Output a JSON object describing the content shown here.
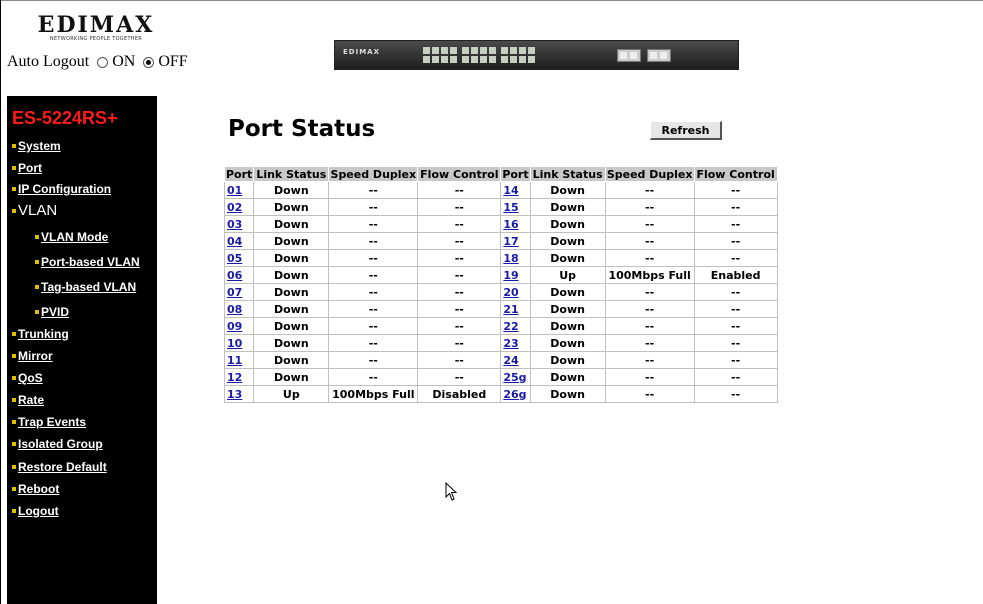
{
  "header": {
    "logo_text": "EDIMAX",
    "logo_tagline": "NETWORKING PEOPLE TOGETHER",
    "auto_logout_label": "Auto Logout",
    "option_on": "ON",
    "option_off": "OFF",
    "auto_logout_selected": "OFF",
    "device_brand": "EDIMAX"
  },
  "sidebar": {
    "model": "ES-5224RS+",
    "items": [
      {
        "label": "System"
      },
      {
        "label": "Port"
      },
      {
        "label": "IP Configuration"
      },
      {
        "label": "VLAN"
      },
      {
        "label": "VLAN Mode"
      },
      {
        "label": "Port-based VLAN"
      },
      {
        "label": "Tag-based VLAN"
      },
      {
        "label": "PVID"
      },
      {
        "label": "Trunking"
      },
      {
        "label": "Mirror"
      },
      {
        "label": "QoS"
      },
      {
        "label": "Rate"
      },
      {
        "label": "Trap Events"
      },
      {
        "label": "Isolated Group"
      },
      {
        "label": "Restore Default"
      },
      {
        "label": "Reboot"
      },
      {
        "label": "Logout"
      }
    ]
  },
  "main": {
    "title": "Port Status",
    "refresh_label": "Refresh",
    "columns": [
      "Port",
      "Link Status",
      "Speed Duplex",
      "Flow Control",
      "Port",
      "Link Status",
      "Speed Duplex",
      "Flow Control"
    ],
    "rows": [
      [
        "01",
        "Down",
        "--",
        "--",
        "14",
        "Down",
        "--",
        "--"
      ],
      [
        "02",
        "Down",
        "--",
        "--",
        "15",
        "Down",
        "--",
        "--"
      ],
      [
        "03",
        "Down",
        "--",
        "--",
        "16",
        "Down",
        "--",
        "--"
      ],
      [
        "04",
        "Down",
        "--",
        "--",
        "17",
        "Down",
        "--",
        "--"
      ],
      [
        "05",
        "Down",
        "--",
        "--",
        "18",
        "Down",
        "--",
        "--"
      ],
      [
        "06",
        "Down",
        "--",
        "--",
        "19",
        "Up",
        "100Mbps Full",
        "Enabled"
      ],
      [
        "07",
        "Down",
        "--",
        "--",
        "20",
        "Down",
        "--",
        "--"
      ],
      [
        "08",
        "Down",
        "--",
        "--",
        "21",
        "Down",
        "--",
        "--"
      ],
      [
        "09",
        "Down",
        "--",
        "--",
        "22",
        "Down",
        "--",
        "--"
      ],
      [
        "10",
        "Down",
        "--",
        "--",
        "23",
        "Down",
        "--",
        "--"
      ],
      [
        "11",
        "Down",
        "--",
        "--",
        "24",
        "Down",
        "--",
        "--"
      ],
      [
        "12",
        "Down",
        "--",
        "--",
        "25g",
        "Down",
        "--",
        "--"
      ],
      [
        "13",
        "Up",
        "100Mbps Full",
        "Disabled",
        "26g",
        "Down",
        "--",
        "--"
      ]
    ]
  }
}
